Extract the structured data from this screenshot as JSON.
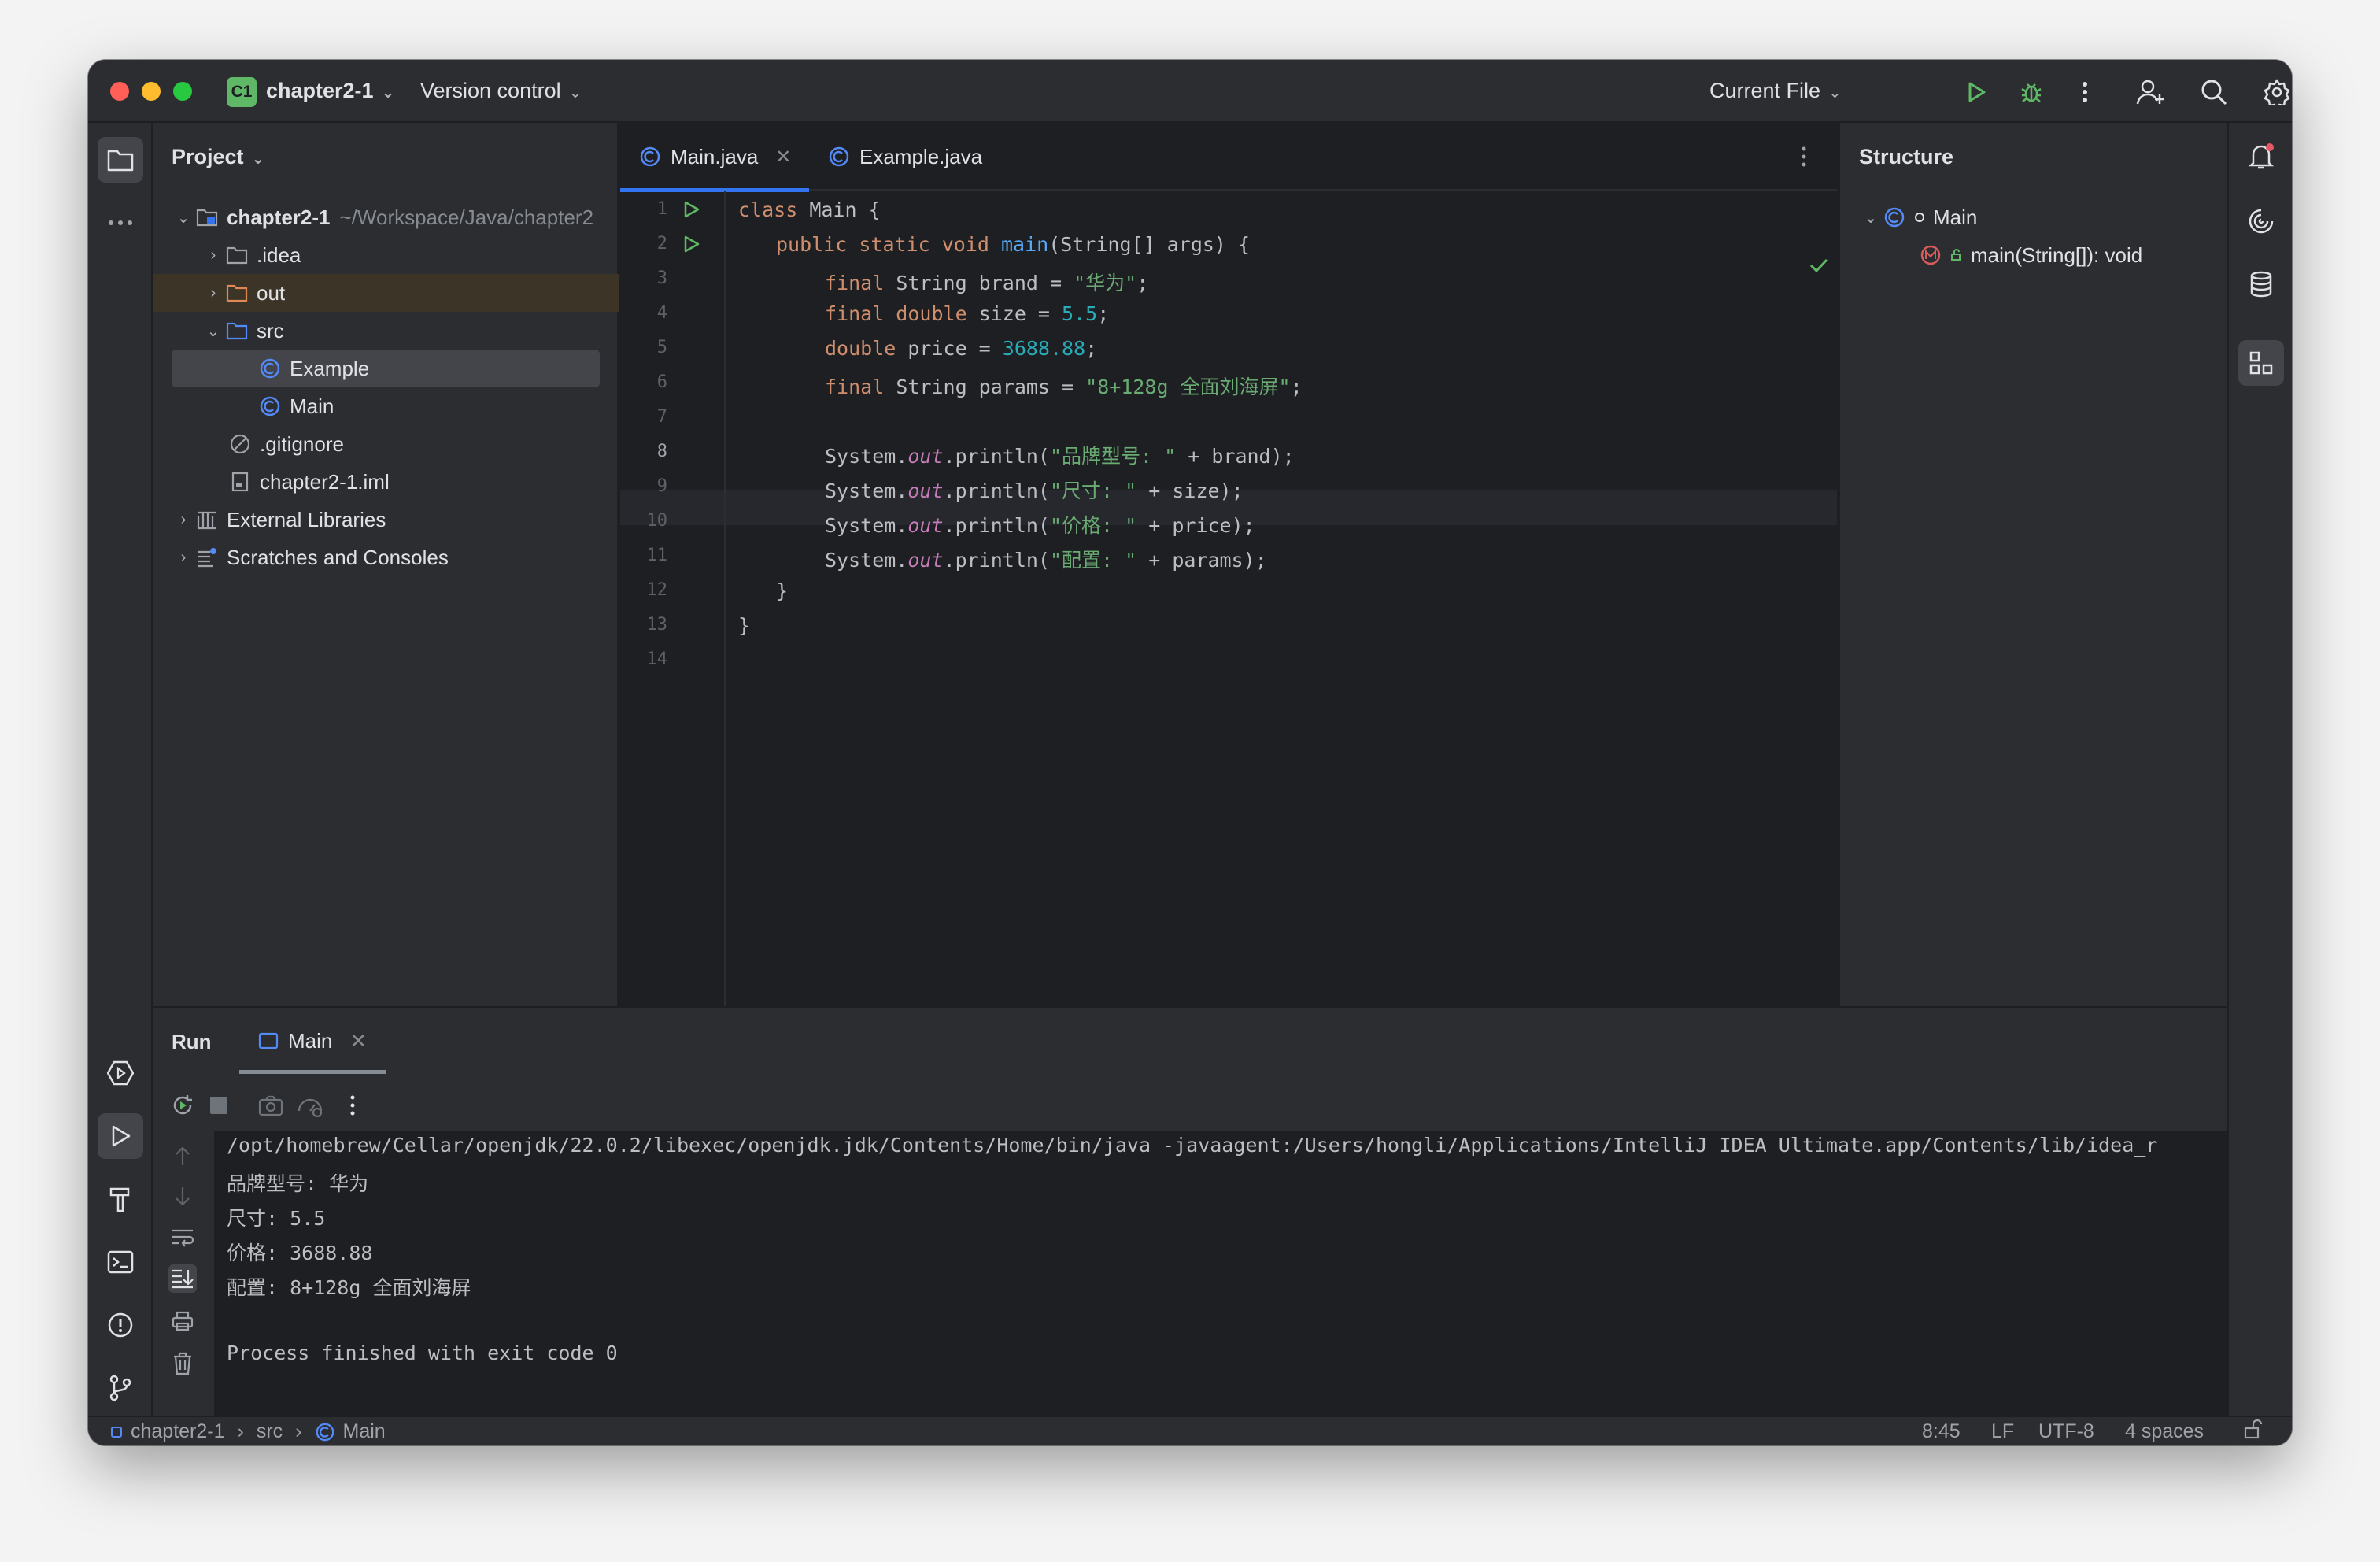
{
  "titlebar": {
    "project_badge": "C1",
    "project_name": "chapter2-1",
    "version_control": "Version control",
    "run_config": "Current File"
  },
  "project_panel": {
    "title": "Project",
    "root_name": "chapter2-1",
    "root_path": "~/Workspace/Java/chapter2",
    "items": [
      {
        "label": ".idea"
      },
      {
        "label": "out"
      },
      {
        "label": "src"
      },
      {
        "label": "Example"
      },
      {
        "label": "Main"
      },
      {
        "label": ".gitignore"
      },
      {
        "label": "chapter2-1.iml"
      },
      {
        "label": "External Libraries"
      },
      {
        "label": "Scratches and Consoles"
      }
    ]
  },
  "editor": {
    "tabs": [
      {
        "label": "Main.java"
      },
      {
        "label": "Example.java"
      }
    ],
    "line_numbers": [
      "1",
      "2",
      "3",
      "4",
      "5",
      "6",
      "7",
      "8",
      "9",
      "10",
      "11",
      "12",
      "13",
      "14"
    ],
    "code": {
      "l1_kw": "class",
      "l1_rest": " Main {",
      "l2_kw": "public static void ",
      "l2_fn": "main",
      "l2_rest": "(String[] args) {",
      "l3_kw": "final",
      "l3_mid": " String brand = ",
      "l3_str": "\"华为\"",
      "l3_end": ";",
      "l4_kw": "final double",
      "l4_mid": " size = ",
      "l4_num": "5.5",
      "l4_end": ";",
      "l5_kw": "double",
      "l5_mid": " price = ",
      "l5_num": "3688.88",
      "l5_end": ";",
      "l6_kw": "final",
      "l6_mid": " String params = ",
      "l6_str": "\"8+128g 全面刘海屏\"",
      "l6_end": ";",
      "l8_a": "System.",
      "l8_f": "out",
      "l8_b": ".println(",
      "l8_s": "\"品牌型号: \"",
      "l8_c": " + brand);",
      "l9_a": "System.",
      "l9_f": "out",
      "l9_b": ".println(",
      "l9_s": "\"尺寸: \"",
      "l9_c": " + size);",
      "l10_a": "System.",
      "l10_f": "out",
      "l10_b": ".println(",
      "l10_s": "\"价格: \"",
      "l10_c": " + price);",
      "l11_a": "System.",
      "l11_f": "out",
      "l11_b": ".println(",
      "l11_s": "\"配置: \"",
      "l11_c": " + params);",
      "l12": "}",
      "l13": "}"
    }
  },
  "structure_panel": {
    "title": "Structure",
    "class_name": "Main",
    "method": "main(String[]): void"
  },
  "run_panel": {
    "title": "Run",
    "tab_label": "Main",
    "console": [
      "/opt/homebrew/Cellar/openjdk/22.0.2/libexec/openjdk.jdk/Contents/Home/bin/java -javaagent:/Users/hongli/Applications/IntelliJ IDEA Ultimate.app/Contents/lib/idea_r",
      "品牌型号: 华为",
      "尺寸: 5.5",
      "价格: 3688.88",
      "配置: 8+128g 全面刘海屏",
      "",
      "Process finished with exit code 0"
    ]
  },
  "statusbar": {
    "crumb_project": "chapter2-1",
    "crumb_src": "src",
    "crumb_class": "Main",
    "position": "8:45",
    "line_sep": "LF",
    "encoding": "UTF-8",
    "indent": "4 spaces"
  },
  "colors": {
    "accent": "#3574f0",
    "run_green": "#5fb865",
    "keyword": "#cf8e6d",
    "string": "#6aab73",
    "number": "#2aacb8"
  }
}
